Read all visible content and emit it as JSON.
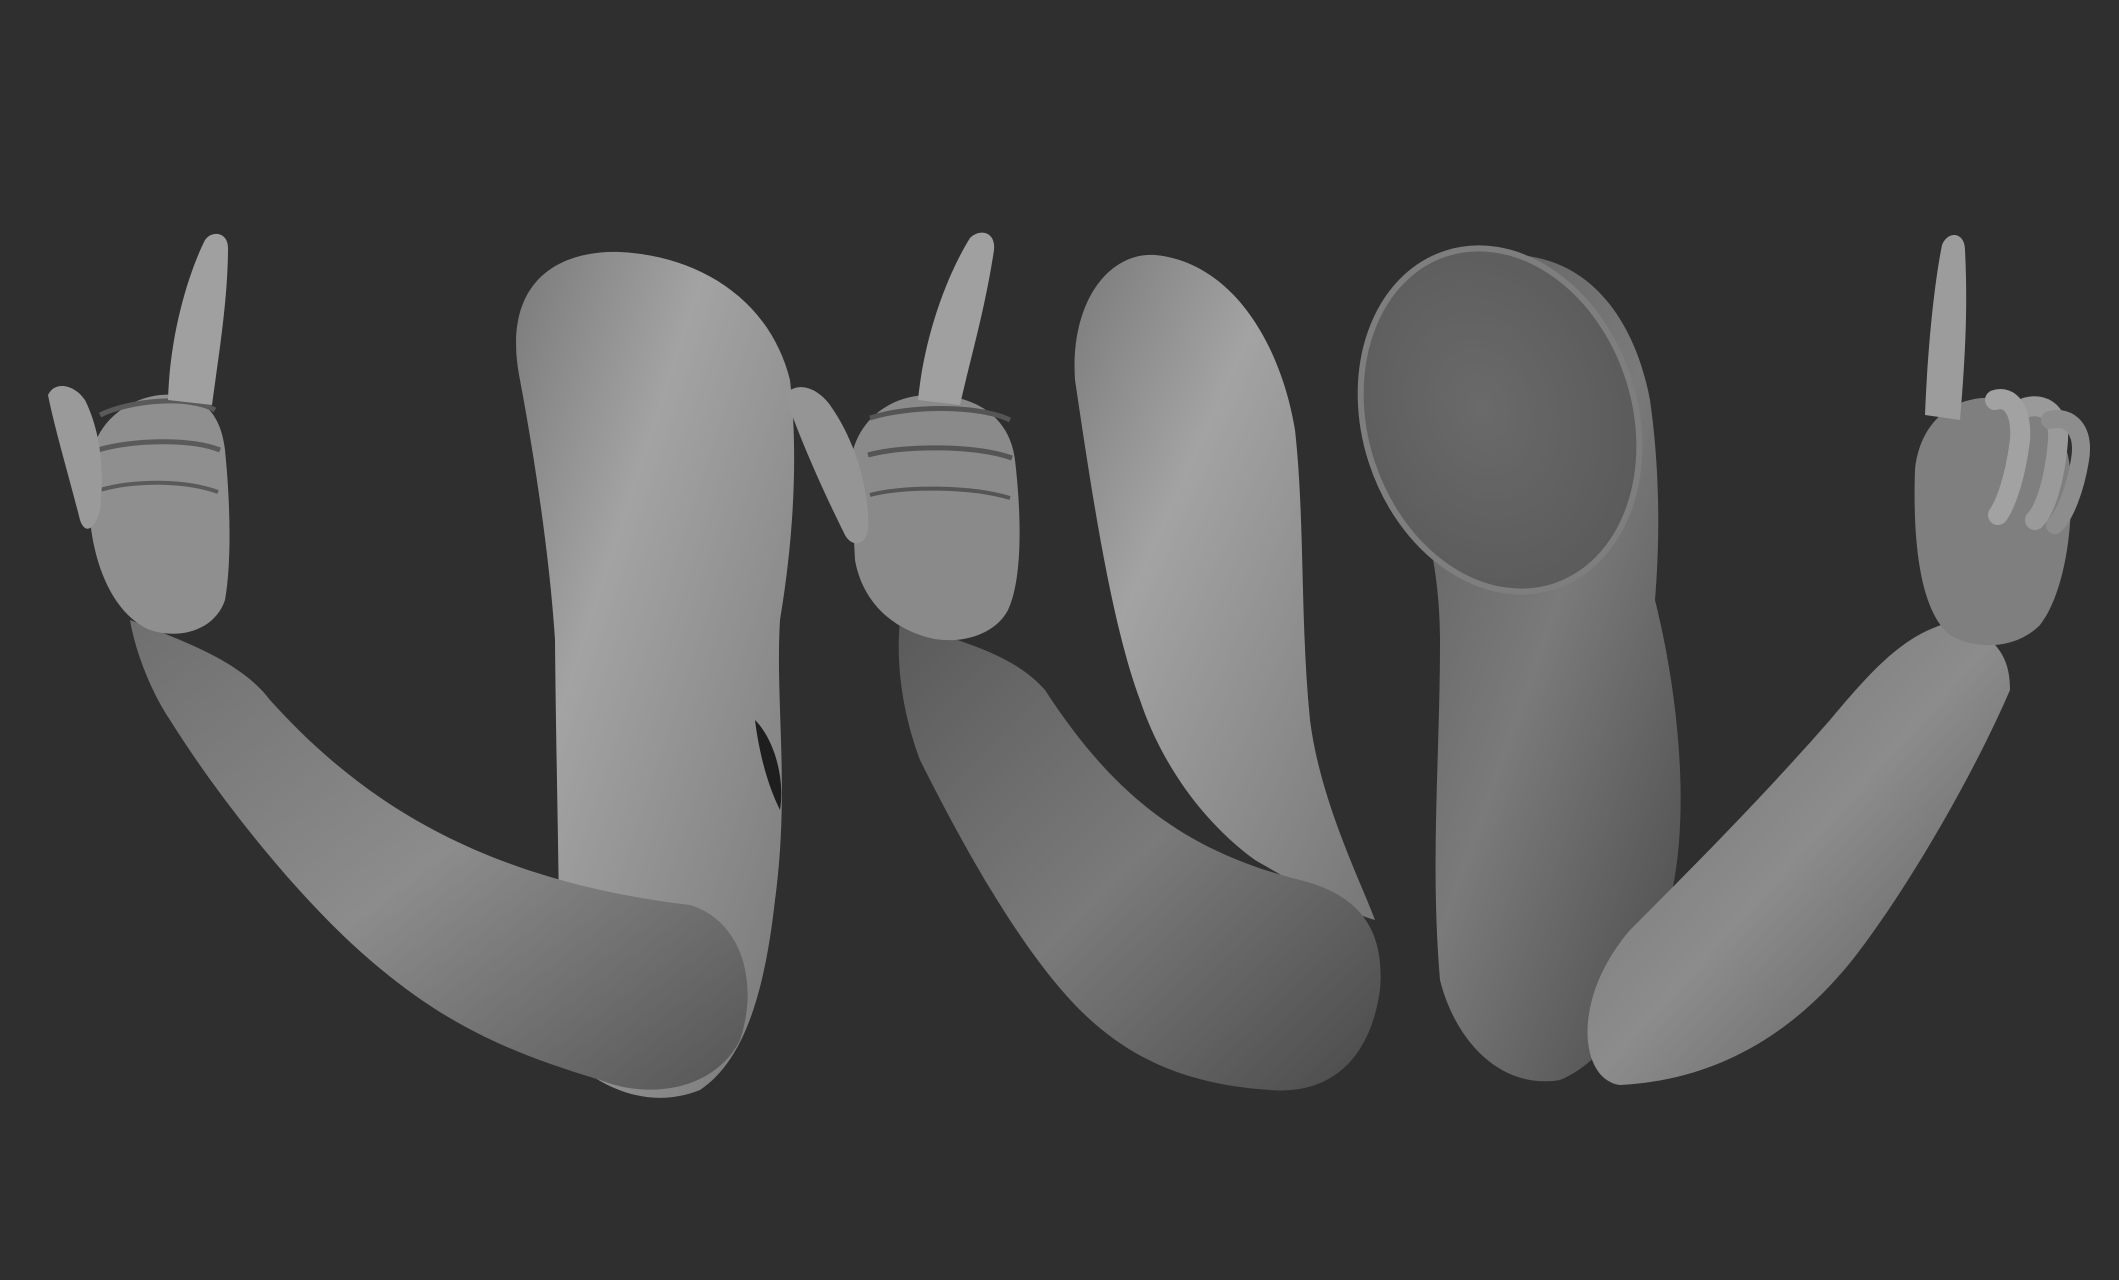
{
  "scene": {
    "background_color": "#2f2f2f",
    "clay_color": "#8a8a8a",
    "views": [
      {
        "id": "front-view",
        "subject": "arm-pointing-up"
      },
      {
        "id": "three-quarter-view",
        "subject": "arm-pointing-up"
      },
      {
        "id": "back-view",
        "subject": "arm-pointing-up"
      }
    ]
  }
}
